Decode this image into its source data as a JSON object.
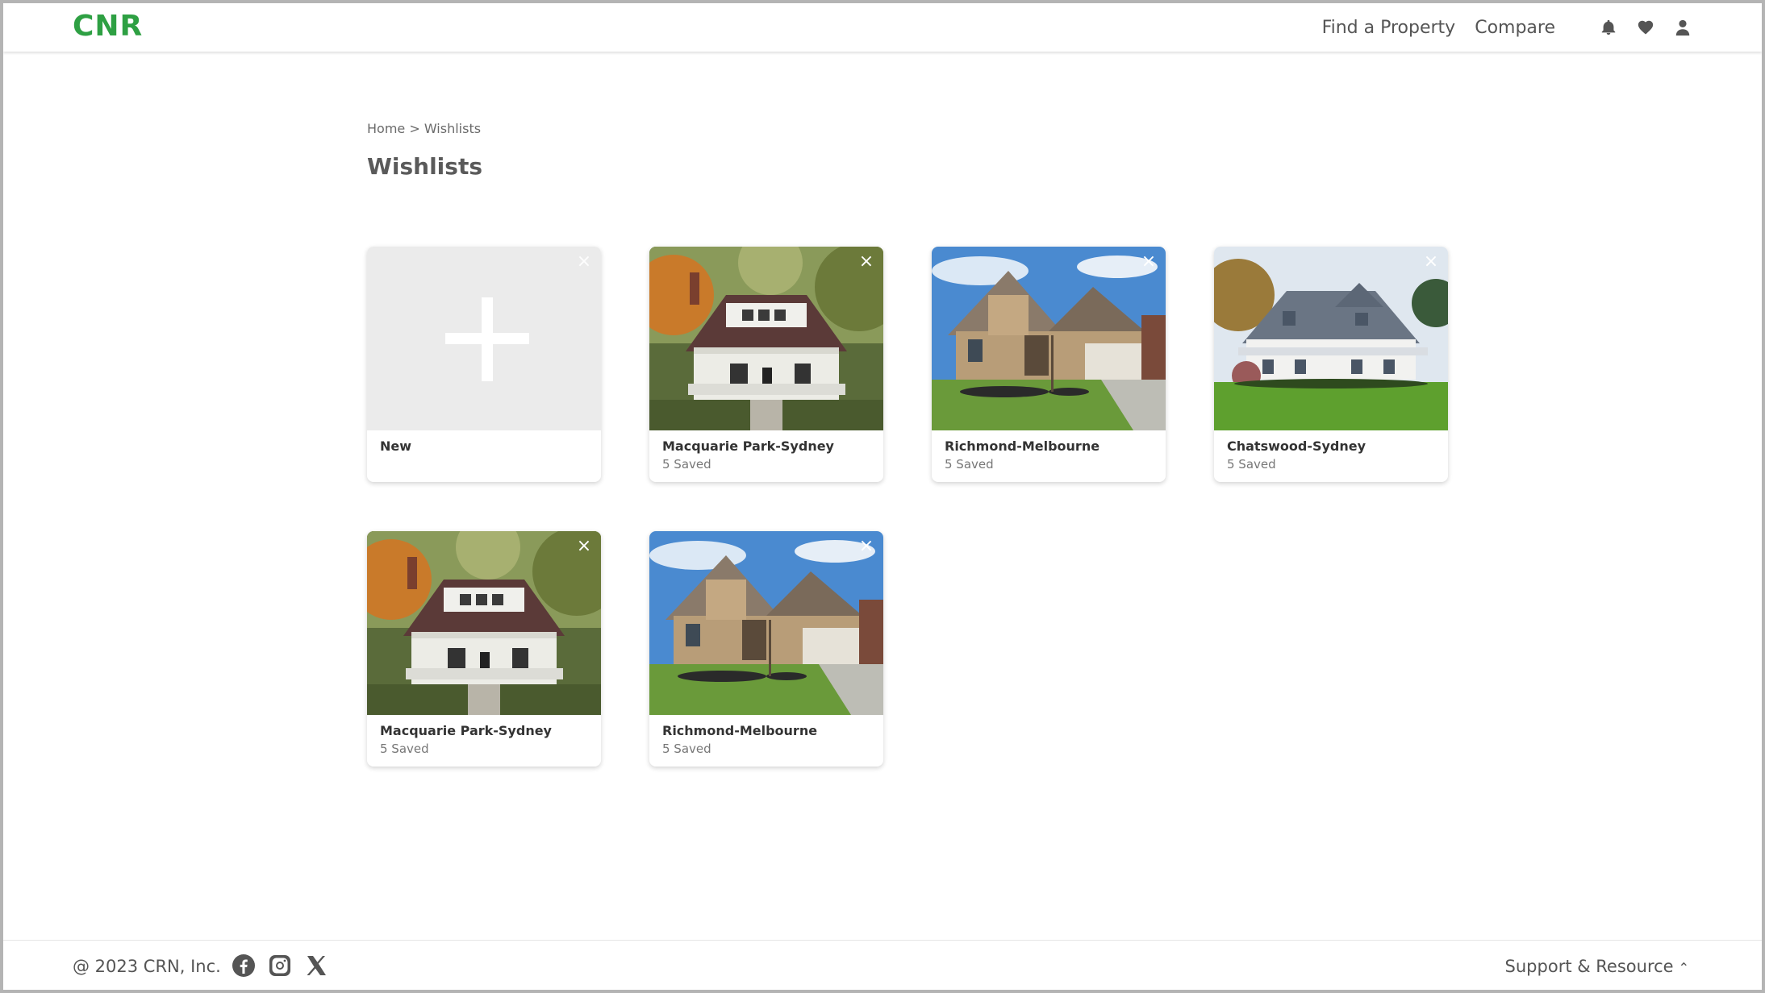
{
  "header": {
    "logo": "CNR",
    "nav": {
      "find_property": "Find a Property",
      "compare": "Compare"
    },
    "icons": [
      "bell-icon",
      "heart-icon",
      "user-icon"
    ]
  },
  "breadcrumb": {
    "home": "Home",
    "separator": " > ",
    "current": "Wishlists"
  },
  "page_title": "Wishlists",
  "cards": [
    {
      "title": "New",
      "subtitle": "",
      "image": "plus",
      "close": "×"
    },
    {
      "title": "Macquarie Park-Sydney",
      "subtitle": "5 Saved",
      "image": "craftsman-house",
      "close": "×"
    },
    {
      "title": "Richmond-Melbourne",
      "subtitle": "5 Saved",
      "image": "brick-house",
      "close": "×"
    },
    {
      "title": "Chatswood-Sydney",
      "subtitle": "5 Saved",
      "image": "farmhouse",
      "close": "×"
    },
    {
      "title": "Macquarie Park-Sydney",
      "subtitle": "5 Saved",
      "image": "craftsman-house",
      "close": "×"
    },
    {
      "title": "Richmond-Melbourne",
      "subtitle": "5 Saved",
      "image": "brick-house",
      "close": "×"
    }
  ],
  "footer": {
    "copyright": "@ 2023 CRN, Inc.",
    "social": [
      "facebook-icon",
      "instagram-icon",
      "x-icon"
    ],
    "support": "Support & Resource"
  },
  "colors": {
    "brand": "#2ea043",
    "text": "#555555",
    "placeholder": "#ebebeb"
  }
}
